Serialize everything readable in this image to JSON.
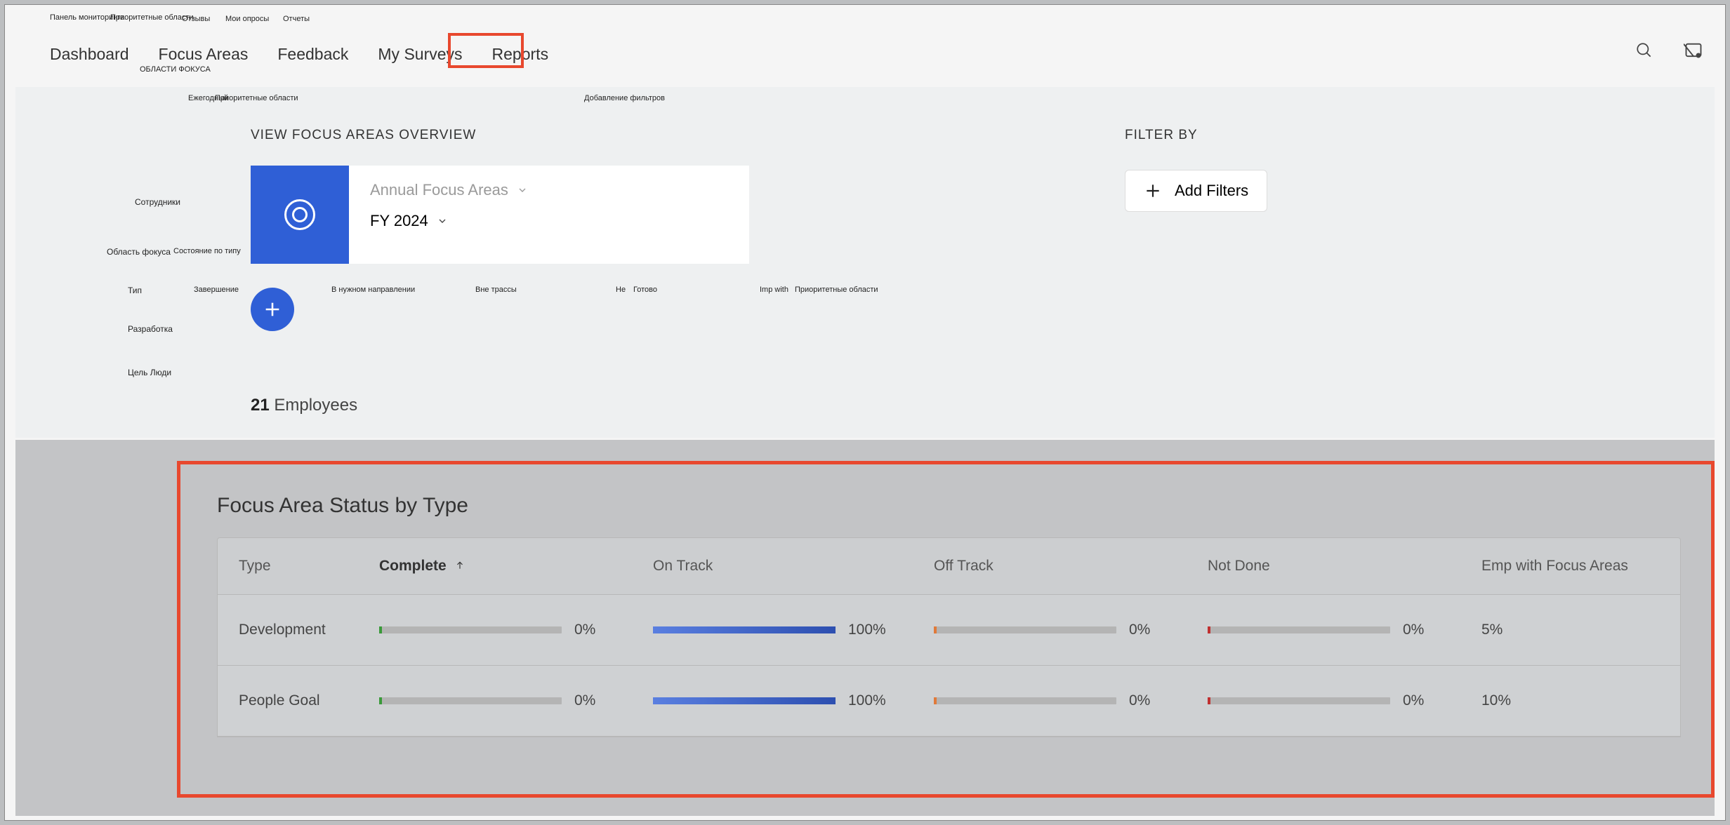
{
  "ru_labels": {
    "top": [
      "Панель мониторинга",
      "Приоритетные области",
      "Отзывы",
      "Мои опросы",
      "Отчеты"
    ],
    "sub_focus": "ОБЛАСТИ ФОКУСА",
    "side": [
      "Сотрудники",
      "Область фокуса",
      "Тип",
      "Разработка",
      "Цель Люди"
    ],
    "yearly": "Ежегодный",
    "priority": "Приоритетные области",
    "add_filters": "Добавление фильтров",
    "status_by_type": "Состояние по типу",
    "cols": [
      "Завершение",
      "В нужном направлении",
      "Вне трассы",
      "Не",
      "Готово",
      "Imp with",
      "Приоритетные области"
    ]
  },
  "nav": {
    "items": [
      "Dashboard",
      "Focus Areas",
      "Feedback",
      "My Surveys",
      "Reports"
    ],
    "active_index": 4
  },
  "overview": {
    "title": "VIEW FOCUS AREAS OVERVIEW",
    "dropdown1": "Annual Focus Areas",
    "dropdown2": "FY 2024",
    "employees_count": "21",
    "employees_label": "Employees"
  },
  "filter": {
    "title": "FILTER BY",
    "add_button": "Add Filters"
  },
  "table": {
    "title": "Focus Area Status by Type",
    "columns": [
      "Type",
      "Complete",
      "On Track",
      "Off Track",
      "Not Done",
      "Emp with Focus Areas"
    ],
    "sort_col": 1,
    "rows": [
      {
        "type": "Development",
        "complete": "0%",
        "on_track": "100%",
        "off_track": "0%",
        "not_done": "0%",
        "emp": "5%"
      },
      {
        "type": "People Goal",
        "complete": "0%",
        "on_track": "100%",
        "off_track": "0%",
        "not_done": "0%",
        "emp": "10%"
      }
    ]
  },
  "chart_data": {
    "type": "table",
    "title": "Focus Area Status by Type",
    "columns": [
      "Type",
      "Complete",
      "On Track",
      "Off Track",
      "Not Done",
      "Emp with Focus Areas"
    ],
    "rows": [
      [
        "Development",
        0,
        100,
        0,
        0,
        5
      ],
      [
        "People Goal",
        0,
        100,
        0,
        0,
        10
      ]
    ],
    "units": "%"
  }
}
